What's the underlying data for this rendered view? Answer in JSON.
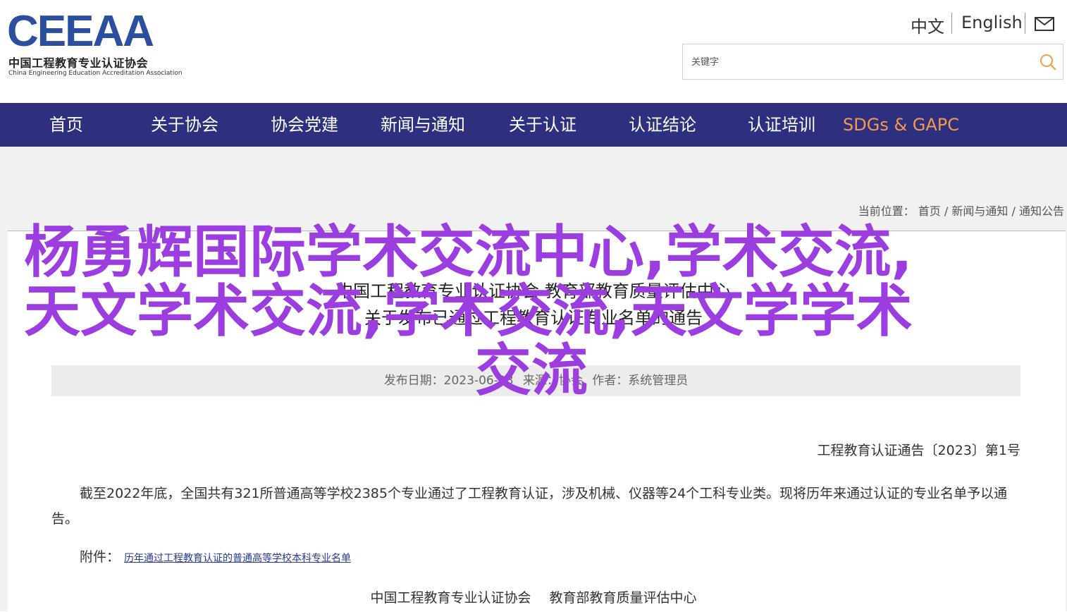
{
  "header": {
    "logo_mark": "CEEAA",
    "logo_cn": "中国工程教育专业认证协会",
    "logo_en": "China Engineering Education Accreditation Association",
    "lang_zh": "中文",
    "lang_en": "English",
    "mail_icon": "mail-icon",
    "search_placeholder": "关键字",
    "search_icon": "search-icon"
  },
  "nav": {
    "items": [
      {
        "label": "首页"
      },
      {
        "label": "关于协会"
      },
      {
        "label": "协会党建"
      },
      {
        "label": "新闻与通知"
      },
      {
        "label": "关于认证"
      },
      {
        "label": "认证结论"
      },
      {
        "label": "认证培训"
      },
      {
        "label": "SDGs & GAPC"
      }
    ],
    "accent_color": "#f49a4a",
    "background": "#2d2f7f"
  },
  "breadcrumb": {
    "prefix": "当前位置：",
    "items": [
      "首页",
      "新闻与通知",
      "通知公告"
    ],
    "separator": "/"
  },
  "article": {
    "title_line1": "中国工程教育专业认证协会 教育部教育质量评估中心",
    "title_line2": "关于发布已通过工程教育认证专业名单的通告",
    "meta": {
      "date": "发布日期：2023-06-28",
      "source": "来源：协会",
      "author": "作者：系统管理员"
    },
    "doc_no": "工程教育认证通告〔2023〕第1号",
    "paragraph": "截至2022年底，全国共有321所普通高等学校2385个专业通过了工程教育认证，涉及机械、仪器等24个工科专业类。现将历年来通过认证的专业名单予以通告。",
    "attachment_label": "附件：",
    "attachment_link": "历年通过工程教育认证的普通高等学校本科专业名单",
    "sign1": "中国工程教育专业认证协会",
    "sign2": "教育部教育质量评估中心"
  },
  "overlay": {
    "line1": "杨勇辉国际学术交流中心,学术交流,",
    "line2": "天文学术交流,学术交流,天文学学术",
    "line3": "交流",
    "color": "#9c3de0"
  }
}
